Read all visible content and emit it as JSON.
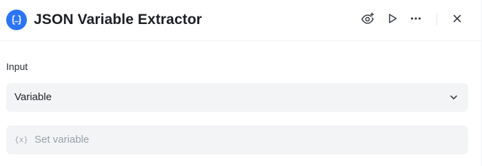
{
  "node": {
    "title": "JSON Variable Extractor",
    "icon": "json-braces-icon",
    "accent_color": "#2b74f5"
  },
  "header_actions": [
    {
      "name": "preview",
      "icon": "eye-plus-icon"
    },
    {
      "name": "run",
      "icon": "play-icon"
    },
    {
      "name": "more",
      "icon": "more-horizontal-icon"
    },
    {
      "name": "close",
      "icon": "close-icon"
    }
  ],
  "input": {
    "label": "Input",
    "select_value": "Variable",
    "variable_icon_text": "{x}",
    "variable_placeholder": "Set variable"
  }
}
